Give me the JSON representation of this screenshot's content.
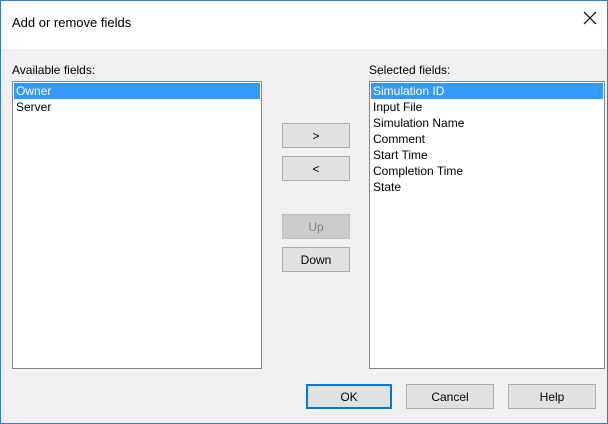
{
  "dialog": {
    "title": "Add or remove fields"
  },
  "available": {
    "label": "Available fields:",
    "items": [
      "Owner",
      "Server"
    ],
    "selected_index": 0
  },
  "selected": {
    "label": "Selected fields:",
    "items": [
      "Simulation ID",
      "Input File",
      "Simulation Name",
      "Comment",
      "Start Time",
      "Completion Time",
      "State"
    ],
    "selected_index": 0
  },
  "buttons": {
    "add": ">",
    "remove": "<",
    "up": "Up",
    "down": "Down",
    "ok": "OK",
    "cancel": "Cancel",
    "help": "Help"
  },
  "button_states": {
    "up_enabled": false,
    "ok_default": true
  },
  "icons": {
    "close": "close-icon"
  },
  "colors": {
    "selection": "#3399ff",
    "selection_text": "#ffffff",
    "window_border": "#3c78c8",
    "dialog_background": "#f0f0f0",
    "disabled_text": "#838383"
  }
}
